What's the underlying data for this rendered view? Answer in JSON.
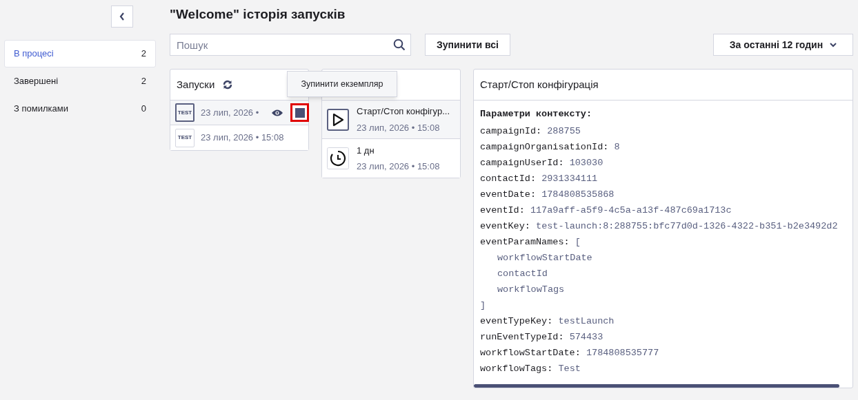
{
  "sidebar": {
    "items": [
      {
        "label": "В процесі",
        "count": "2",
        "selected": true
      },
      {
        "label": "Завершені",
        "count": "2",
        "selected": false
      },
      {
        "label": "З помилками",
        "count": "0",
        "selected": false
      }
    ]
  },
  "title": "\"Welcome\" історія запусків",
  "search": {
    "placeholder": "Пошук"
  },
  "stop_all_button": "Зупинити всі",
  "period_dropdown": "За останні 12 годин",
  "runs": {
    "title": "Запуски",
    "tooltip": "Зупинити екземпляр",
    "items": [
      {
        "badge": "TEST",
        "date": "23 лип, 2026 •",
        "selected": true,
        "actions": true
      },
      {
        "badge": "TEST",
        "date": "23 лип, 2026 • 15:08",
        "selected": false,
        "actions": false
      }
    ]
  },
  "steps": {
    "items": [
      {
        "kind": "start",
        "name": "Старт/Стоп конфігур...",
        "date": "23 лип, 2026 • 15:08",
        "selected": true
      },
      {
        "kind": "timer",
        "name": "1 дн",
        "date": "23 лип, 2026 • 15:08",
        "selected": false
      }
    ]
  },
  "details": {
    "title": "Старт/Стоп конфігурація",
    "heading": "Параметри контексту:",
    "lines": [
      {
        "kind": "pair",
        "key": "campaignId:",
        "value": "288755"
      },
      {
        "kind": "pair",
        "key": "campaignOrganisationId:",
        "value": "8"
      },
      {
        "kind": "pair",
        "key": "campaignUserId:",
        "value": "103030"
      },
      {
        "kind": "pair",
        "key": "contactId:",
        "value": "2931334111"
      },
      {
        "kind": "pair",
        "key": "eventDate:",
        "value": "1784808535868"
      },
      {
        "kind": "pair",
        "key": "eventId:",
        "value": "117a9aff-a5f9-4c5a-a13f-487c69a1713c"
      },
      {
        "kind": "pair",
        "key": "eventKey:",
        "value": "test-launch:8:288755:bfc77d0d-1326-4322-b351-b2e3492d2"
      },
      {
        "kind": "pair",
        "key": "eventParamNames:",
        "value": "["
      },
      {
        "kind": "item",
        "value": "workflowStartDate"
      },
      {
        "kind": "item",
        "value": "contactId"
      },
      {
        "kind": "item",
        "value": "workflowTags"
      },
      {
        "kind": "close",
        "value": "]"
      },
      {
        "kind": "pair",
        "key": "eventTypeKey:",
        "value": "testLaunch"
      },
      {
        "kind": "pair",
        "key": "runEventTypeId:",
        "value": "574433"
      },
      {
        "kind": "pair",
        "key": "workflowStartDate:",
        "value": "1784808535777"
      },
      {
        "kind": "pair",
        "key": "workflowTags:",
        "value": "Test"
      }
    ]
  }
}
